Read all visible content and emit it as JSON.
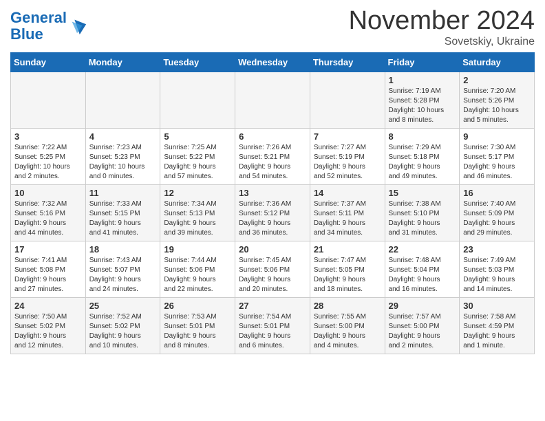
{
  "header": {
    "logo_general": "General",
    "logo_blue": "Blue",
    "month_title": "November 2024",
    "location": "Sovetskiy, Ukraine"
  },
  "weekdays": [
    "Sunday",
    "Monday",
    "Tuesday",
    "Wednesday",
    "Thursday",
    "Friday",
    "Saturday"
  ],
  "weeks": [
    [
      {
        "day": "",
        "info": ""
      },
      {
        "day": "",
        "info": ""
      },
      {
        "day": "",
        "info": ""
      },
      {
        "day": "",
        "info": ""
      },
      {
        "day": "",
        "info": ""
      },
      {
        "day": "1",
        "info": "Sunrise: 7:19 AM\nSunset: 5:28 PM\nDaylight: 10 hours\nand 8 minutes."
      },
      {
        "day": "2",
        "info": "Sunrise: 7:20 AM\nSunset: 5:26 PM\nDaylight: 10 hours\nand 5 minutes."
      }
    ],
    [
      {
        "day": "3",
        "info": "Sunrise: 7:22 AM\nSunset: 5:25 PM\nDaylight: 10 hours\nand 2 minutes."
      },
      {
        "day": "4",
        "info": "Sunrise: 7:23 AM\nSunset: 5:23 PM\nDaylight: 10 hours\nand 0 minutes."
      },
      {
        "day": "5",
        "info": "Sunrise: 7:25 AM\nSunset: 5:22 PM\nDaylight: 9 hours\nand 57 minutes."
      },
      {
        "day": "6",
        "info": "Sunrise: 7:26 AM\nSunset: 5:21 PM\nDaylight: 9 hours\nand 54 minutes."
      },
      {
        "day": "7",
        "info": "Sunrise: 7:27 AM\nSunset: 5:19 PM\nDaylight: 9 hours\nand 52 minutes."
      },
      {
        "day": "8",
        "info": "Sunrise: 7:29 AM\nSunset: 5:18 PM\nDaylight: 9 hours\nand 49 minutes."
      },
      {
        "day": "9",
        "info": "Sunrise: 7:30 AM\nSunset: 5:17 PM\nDaylight: 9 hours\nand 46 minutes."
      }
    ],
    [
      {
        "day": "10",
        "info": "Sunrise: 7:32 AM\nSunset: 5:16 PM\nDaylight: 9 hours\nand 44 minutes."
      },
      {
        "day": "11",
        "info": "Sunrise: 7:33 AM\nSunset: 5:15 PM\nDaylight: 9 hours\nand 41 minutes."
      },
      {
        "day": "12",
        "info": "Sunrise: 7:34 AM\nSunset: 5:13 PM\nDaylight: 9 hours\nand 39 minutes."
      },
      {
        "day": "13",
        "info": "Sunrise: 7:36 AM\nSunset: 5:12 PM\nDaylight: 9 hours\nand 36 minutes."
      },
      {
        "day": "14",
        "info": "Sunrise: 7:37 AM\nSunset: 5:11 PM\nDaylight: 9 hours\nand 34 minutes."
      },
      {
        "day": "15",
        "info": "Sunrise: 7:38 AM\nSunset: 5:10 PM\nDaylight: 9 hours\nand 31 minutes."
      },
      {
        "day": "16",
        "info": "Sunrise: 7:40 AM\nSunset: 5:09 PM\nDaylight: 9 hours\nand 29 minutes."
      }
    ],
    [
      {
        "day": "17",
        "info": "Sunrise: 7:41 AM\nSunset: 5:08 PM\nDaylight: 9 hours\nand 27 minutes."
      },
      {
        "day": "18",
        "info": "Sunrise: 7:43 AM\nSunset: 5:07 PM\nDaylight: 9 hours\nand 24 minutes."
      },
      {
        "day": "19",
        "info": "Sunrise: 7:44 AM\nSunset: 5:06 PM\nDaylight: 9 hours\nand 22 minutes."
      },
      {
        "day": "20",
        "info": "Sunrise: 7:45 AM\nSunset: 5:06 PM\nDaylight: 9 hours\nand 20 minutes."
      },
      {
        "day": "21",
        "info": "Sunrise: 7:47 AM\nSunset: 5:05 PM\nDaylight: 9 hours\nand 18 minutes."
      },
      {
        "day": "22",
        "info": "Sunrise: 7:48 AM\nSunset: 5:04 PM\nDaylight: 9 hours\nand 16 minutes."
      },
      {
        "day": "23",
        "info": "Sunrise: 7:49 AM\nSunset: 5:03 PM\nDaylight: 9 hours\nand 14 minutes."
      }
    ],
    [
      {
        "day": "24",
        "info": "Sunrise: 7:50 AM\nSunset: 5:02 PM\nDaylight: 9 hours\nand 12 minutes."
      },
      {
        "day": "25",
        "info": "Sunrise: 7:52 AM\nSunset: 5:02 PM\nDaylight: 9 hours\nand 10 minutes."
      },
      {
        "day": "26",
        "info": "Sunrise: 7:53 AM\nSunset: 5:01 PM\nDaylight: 9 hours\nand 8 minutes."
      },
      {
        "day": "27",
        "info": "Sunrise: 7:54 AM\nSunset: 5:01 PM\nDaylight: 9 hours\nand 6 minutes."
      },
      {
        "day": "28",
        "info": "Sunrise: 7:55 AM\nSunset: 5:00 PM\nDaylight: 9 hours\nand 4 minutes."
      },
      {
        "day": "29",
        "info": "Sunrise: 7:57 AM\nSunset: 5:00 PM\nDaylight: 9 hours\nand 2 minutes."
      },
      {
        "day": "30",
        "info": "Sunrise: 7:58 AM\nSunset: 4:59 PM\nDaylight: 9 hours\nand 1 minute."
      }
    ]
  ]
}
